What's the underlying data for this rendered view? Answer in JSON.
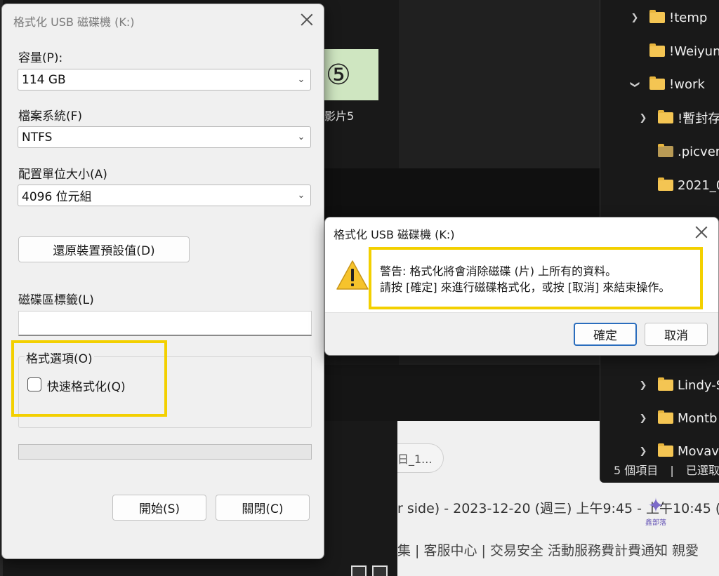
{
  "background": {
    "thumbnail_number": "⑤",
    "thumbnail_caption": "影片5",
    "chip_text": "日_1...",
    "event_text": "r side) - 2023-12-20 (週三) 上午9:45 - 上午10:45 (",
    "footer_links": "集 | 客服中心 | 交易安全 活動服務費計費通知 親愛",
    "watermark_text": "鑫部落"
  },
  "explorer": {
    "items": [
      {
        "label": "!temp",
        "expanded": false
      },
      {
        "label": "!Weiyun",
        "expanded": null
      },
      {
        "label": "!work",
        "expanded": true
      },
      {
        "label": "!暫封存",
        "expanded": false
      },
      {
        "label": ".picver",
        "expanded": null
      },
      {
        "label": "2021_0",
        "expanded": null
      },
      {
        "label": "Lindy-S",
        "expanded": false
      },
      {
        "label": "Montb",
        "expanded": false
      },
      {
        "label": "Movav",
        "expanded": false
      }
    ],
    "status_count": "5 個項目",
    "status_selected": "已選取"
  },
  "format_dialog": {
    "title": "格式化 USB 磁碟機 (K:)",
    "capacity_label": "容量(P):",
    "capacity_value": "114 GB",
    "filesystem_label": "檔案系統(F)",
    "filesystem_value": "NTFS",
    "allocation_label": "配置單位大小(A)",
    "allocation_value": "4096 位元組",
    "restore_button": "還原裝置預設值(D)",
    "volume_label": "磁碟區標籤(L)",
    "volume_value": "",
    "format_options_label": "格式選項(O)",
    "quick_format_label": "快速格式化(Q)",
    "quick_format_checked": false,
    "progress": 0,
    "start_button": "開始(S)",
    "close_button": "關閉(C)"
  },
  "warning_dialog": {
    "title": "格式化 USB 磁碟機 (K:)",
    "message_line1": "警告: 格式化將會消除磁碟 (片) 上所有的資料。",
    "message_line2": "請按 [確定] 來進行磁碟格式化，或按 [取消] 來結束操作。",
    "ok_button": "確定",
    "cancel_button": "取消"
  },
  "colors": {
    "highlight": "#f3d000",
    "folder": "#f4c553",
    "dialog_bg": "#f0f0f0",
    "primary_border": "#2a6dbd"
  }
}
